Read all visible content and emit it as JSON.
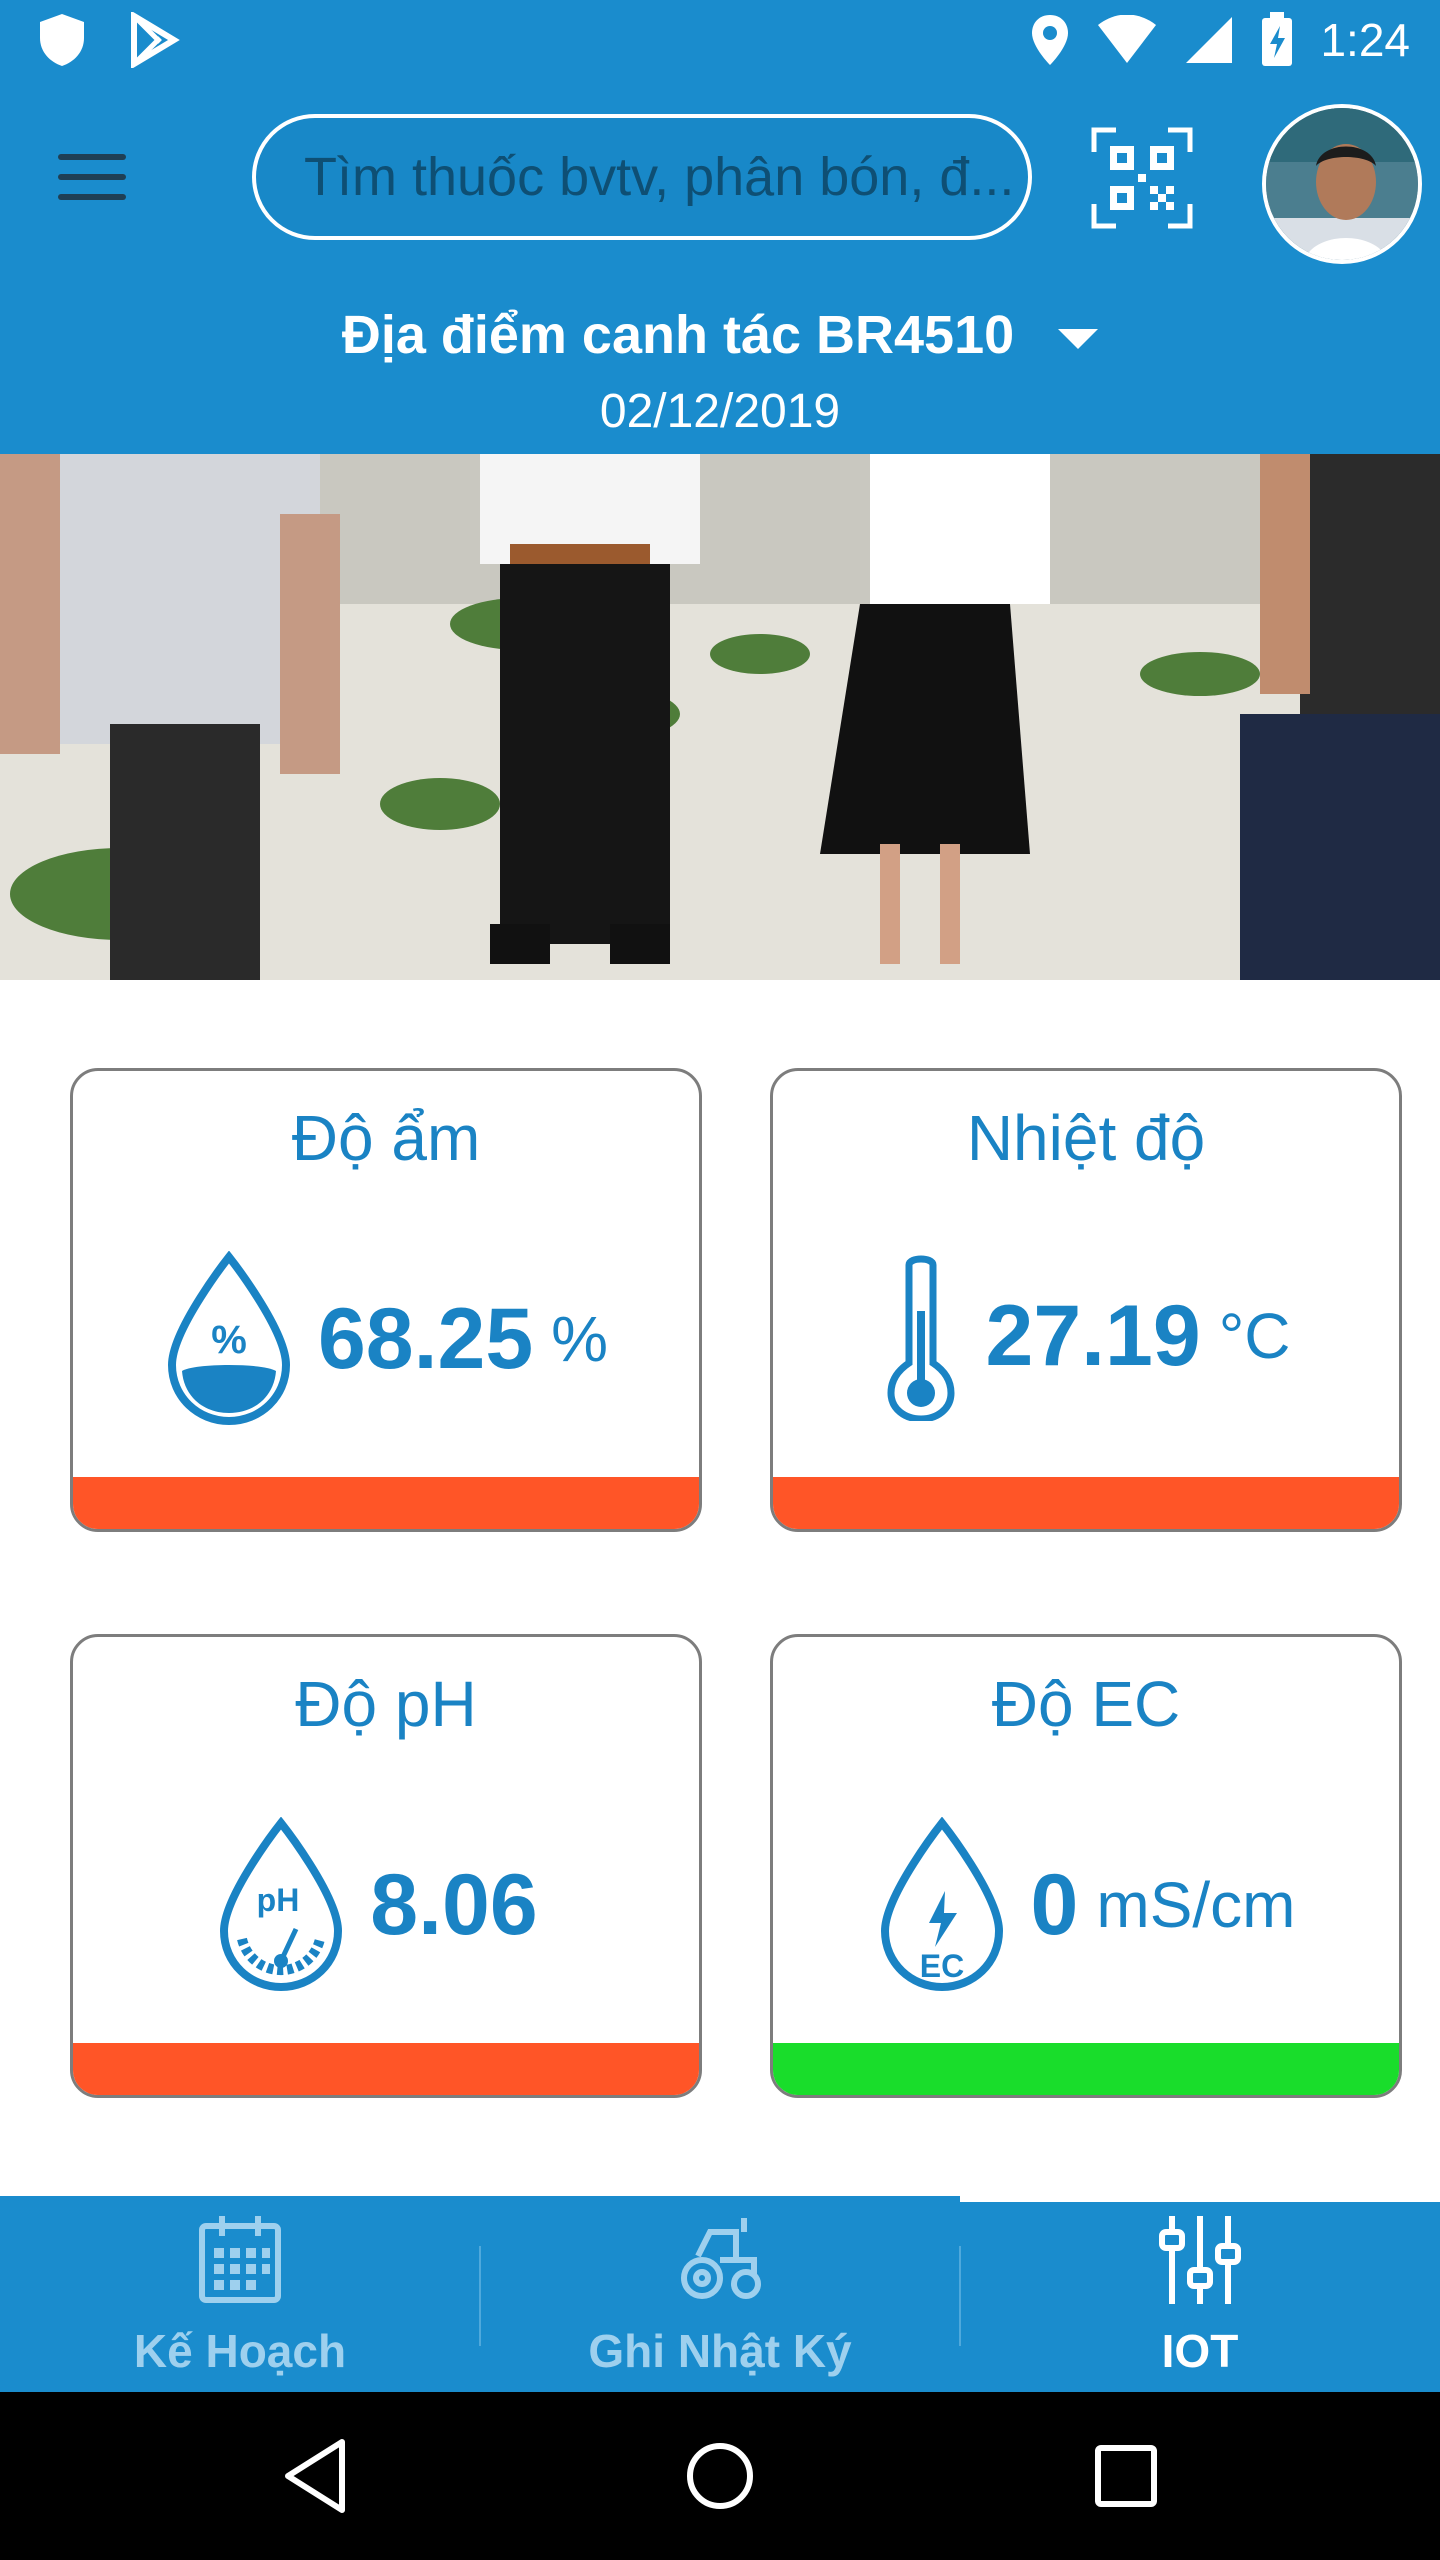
{
  "status_bar": {
    "time": "1:24",
    "left_icons": [
      "shield-icon",
      "play-store-icon"
    ],
    "right_icons": [
      "location-pin-icon",
      "wifi-icon",
      "cell-signal-icon",
      "battery-charging-icon"
    ]
  },
  "header": {
    "search_placeholder": "Tìm thuốc bvtv, phân bón, đ...",
    "menu_icon": "hamburger-menu-icon",
    "qr_icon": "qr-code-icon",
    "avatar": "user-avatar"
  },
  "location": {
    "name": "Địa điểm canh tác BR4510",
    "date": "02/12/2019"
  },
  "sensors": [
    {
      "title": "Độ ẩm",
      "value": "68.25",
      "unit": "%",
      "icon": "humidity-drop-icon",
      "status_color": "#ff5527"
    },
    {
      "title": "Nhiệt độ",
      "value": "27.19",
      "unit": "°C",
      "icon": "thermometer-icon",
      "status_color": "#ff5527"
    },
    {
      "title": "Độ pH",
      "value": "8.06",
      "unit": "",
      "icon": "ph-drop-icon",
      "status_color": "#ff5527"
    },
    {
      "title": "Độ EC",
      "value": "0",
      "unit": "mS/cm",
      "icon": "ec-drop-icon",
      "status_color": "#19dd2b"
    }
  ],
  "bottom_nav": [
    {
      "label": "Kế Hoạch",
      "icon": "calendar-icon",
      "active": false
    },
    {
      "label": "Ghi Nhật Ký",
      "icon": "tractor-icon",
      "active": false
    },
    {
      "label": "IOT",
      "icon": "sliders-icon",
      "active": true
    }
  ],
  "colors": {
    "primary": "#1a8ccd",
    "accent_text": "#1a83c4",
    "alert": "#ff5527",
    "ok": "#19dd2b",
    "inactive_nav": "#9ed0ee"
  }
}
